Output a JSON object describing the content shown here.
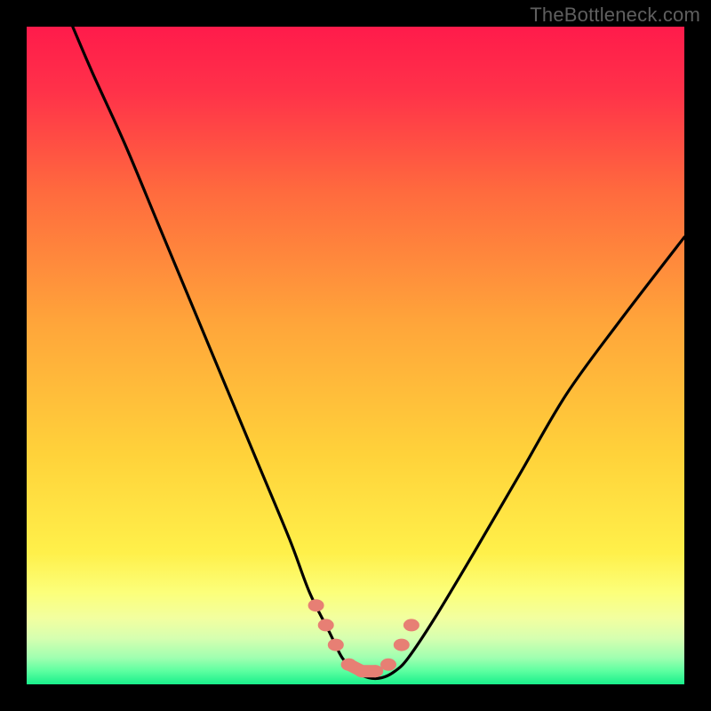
{
  "watermark": {
    "text": "TheBottleneck.com"
  },
  "chart_data": {
    "type": "line",
    "title": "",
    "xlabel": "",
    "ylabel": "",
    "xlim": [
      0,
      100
    ],
    "ylim": [
      0,
      100
    ],
    "series": [
      {
        "name": "bottleneck-curve",
        "x": [
          7,
          10,
          15,
          20,
          25,
          30,
          35,
          40,
          43,
          46,
          48,
          50,
          52,
          54,
          56,
          58,
          62,
          68,
          75,
          82,
          90,
          100
        ],
        "values": [
          100,
          93,
          82,
          70,
          58,
          46,
          34,
          22,
          14,
          8,
          4,
          2,
          1,
          1,
          2,
          4,
          10,
          20,
          32,
          44,
          55,
          68
        ]
      }
    ],
    "markers": {
      "name": "highlight-dots",
      "x": [
        44,
        45.5,
        47,
        49,
        51,
        53,
        55,
        57,
        58.5
      ],
      "values": [
        12,
        9,
        6,
        3,
        2,
        2,
        3,
        6,
        9
      ],
      "color": "#e77f74"
    },
    "gradient_stops": [
      {
        "pos": 0.0,
        "color": "#ff1b4b"
      },
      {
        "pos": 0.1,
        "color": "#ff3249"
      },
      {
        "pos": 0.25,
        "color": "#ff6a3e"
      },
      {
        "pos": 0.45,
        "color": "#ffa53a"
      },
      {
        "pos": 0.65,
        "color": "#ffd23a"
      },
      {
        "pos": 0.8,
        "color": "#fff04a"
      },
      {
        "pos": 0.86,
        "color": "#fcff7a"
      },
      {
        "pos": 0.9,
        "color": "#f2ffa0"
      },
      {
        "pos": 0.93,
        "color": "#d6ffb0"
      },
      {
        "pos": 0.96,
        "color": "#9fffb0"
      },
      {
        "pos": 0.98,
        "color": "#5cffa0"
      },
      {
        "pos": 1.0,
        "color": "#19ef8b"
      }
    ]
  }
}
